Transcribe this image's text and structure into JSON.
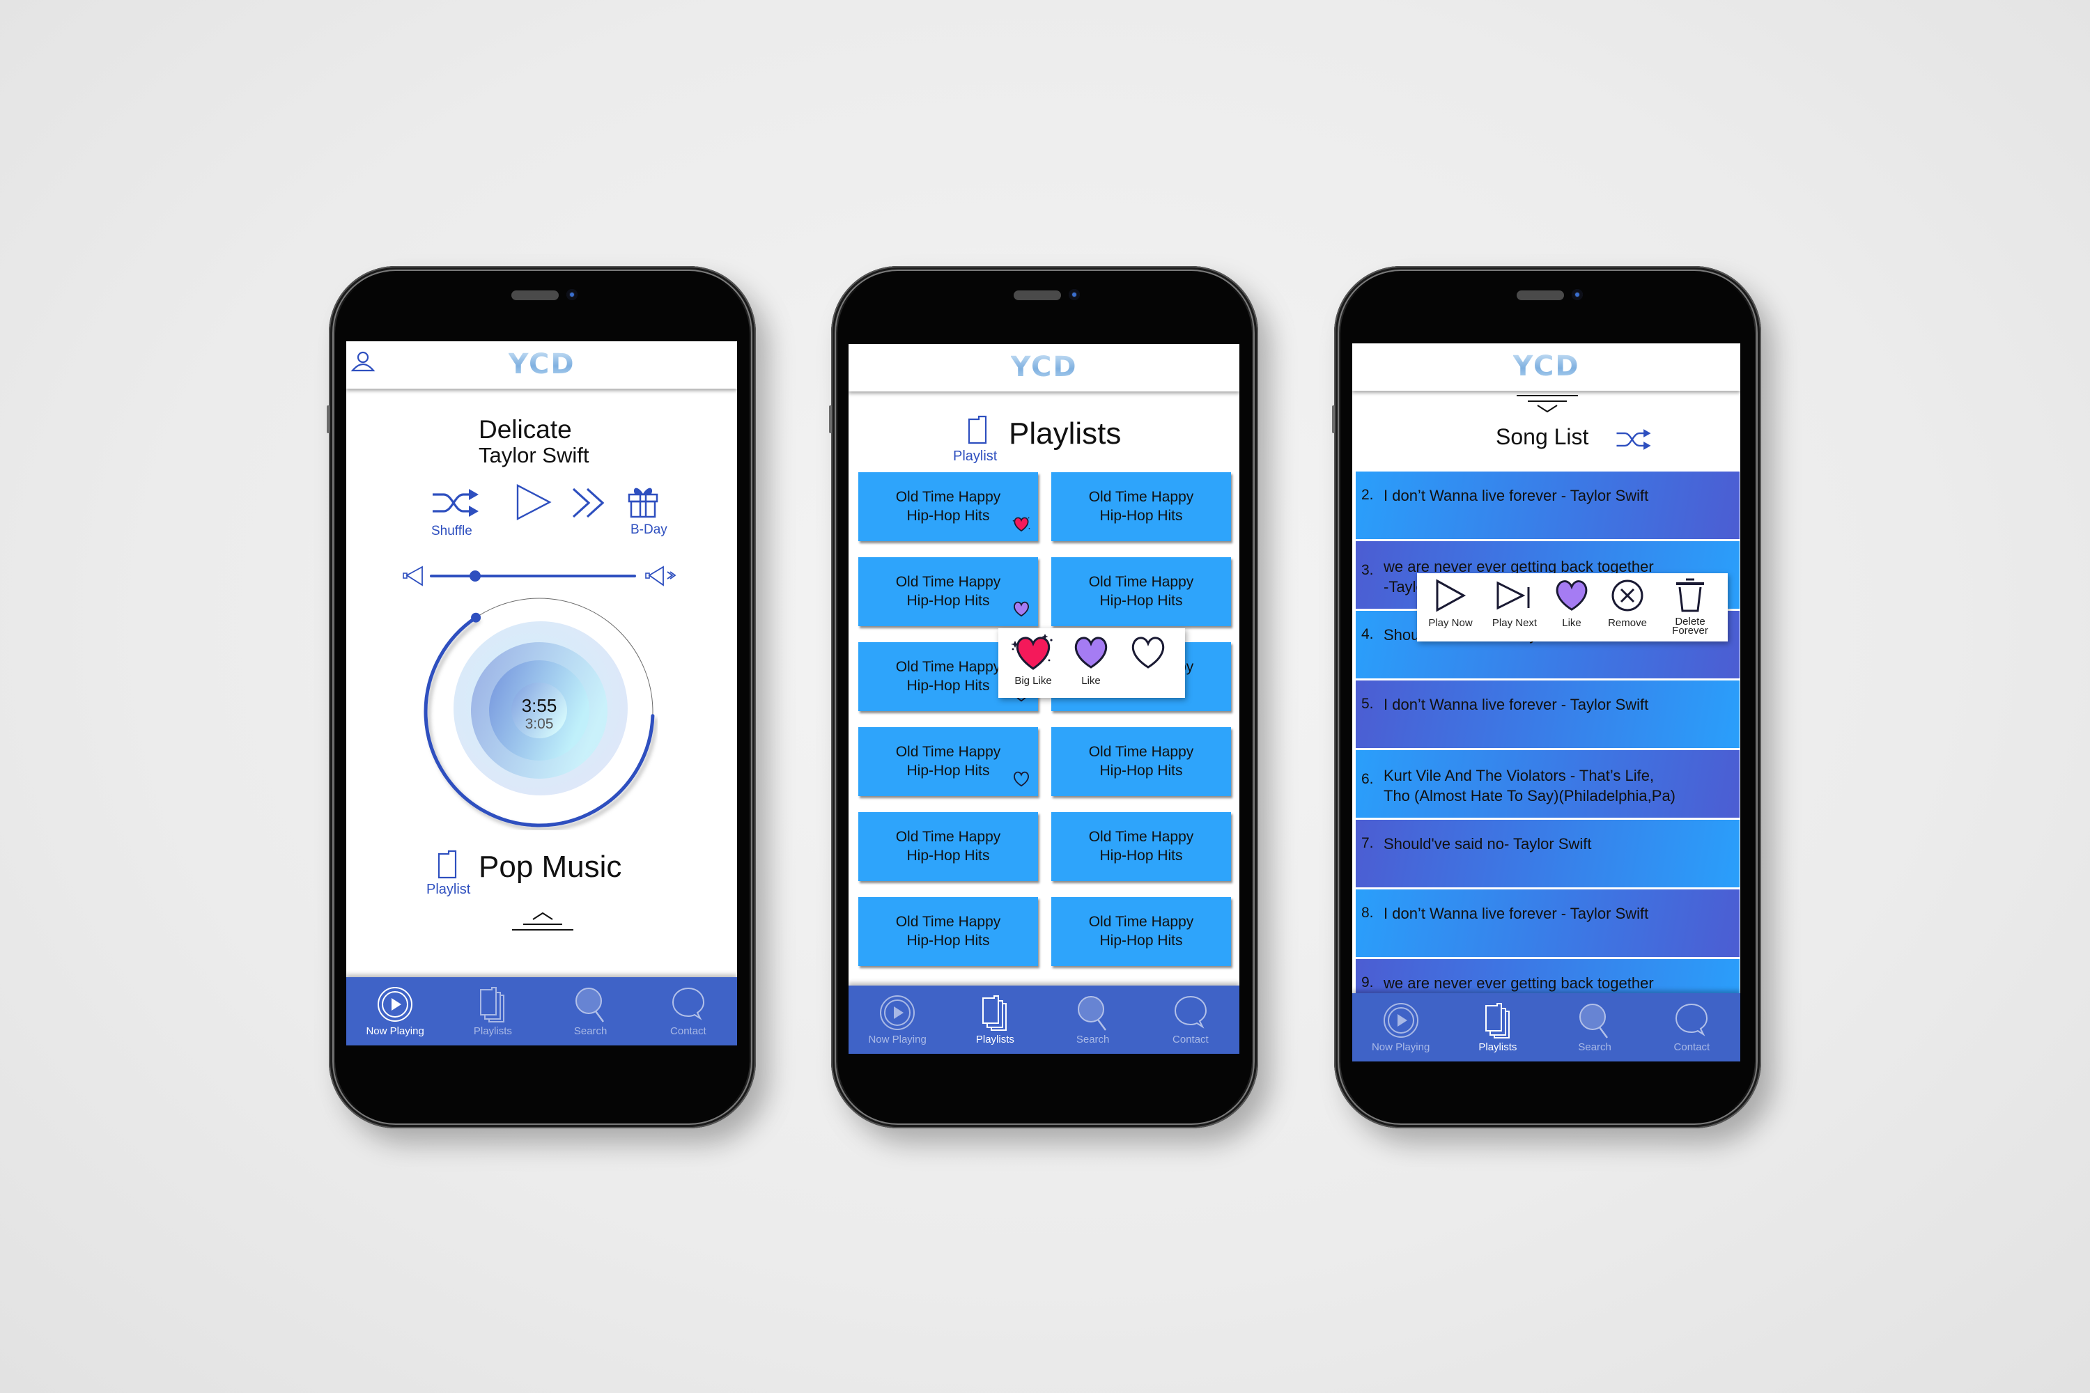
{
  "app": {
    "logo": "YCD"
  },
  "nav": {
    "items": [
      {
        "label": "Now Playing",
        "icon": "play-circle-icon"
      },
      {
        "label": "Playlists",
        "icon": "stacked-pages-icon"
      },
      {
        "label": "Search",
        "icon": "search-icon"
      },
      {
        "label": "Contact",
        "icon": "chat-bubble-icon"
      }
    ]
  },
  "colors": {
    "accent": "#2e4fbf",
    "navbar": "#3f63c7",
    "tile": "#2ea4fb",
    "big_like": "#f4195a",
    "like": "#a57cf3"
  },
  "now_playing": {
    "active_tab": "Now Playing",
    "song_title": "Delicate",
    "artist": "Taylor Swift",
    "controls": {
      "shuffle_label": "Shuffle",
      "bday_label": "B-Day"
    },
    "volume_level": 0.22,
    "time_total": "3:55",
    "time_elapsed": "3:05",
    "progress_fraction": 0.78,
    "playlist_name": "Pop Music",
    "playlist_label": "Playlist"
  },
  "playlists": {
    "active_tab": "Playlists",
    "title": "Playlists",
    "icon_label": "Playlist",
    "tiles": [
      {
        "name": "Old Time Happy\nHip-Hop Hits",
        "heart": "big-like"
      },
      {
        "name": "Old Time Happy\nHip-Hop Hits",
        "heart": "none"
      },
      {
        "name": "Old Time Happy\nHip-Hop Hits",
        "heart": "like"
      },
      {
        "name": "Old Time Happy\nHip-Hop Hits",
        "heart": "none"
      },
      {
        "name": "Old Time Happy\nHip-Hop Hits",
        "heart": "outline"
      },
      {
        "name": "Old Time Happy\nHip-Hop Hits",
        "heart": "none"
      },
      {
        "name": "Old Time Happy\nHip-Hop Hits",
        "heart": "outline"
      },
      {
        "name": "Old Time Happy\nHip-Hop Hits",
        "heart": "none"
      },
      {
        "name": "Old Time Happy\nHip-Hop Hits",
        "heart": "none"
      },
      {
        "name": "Old Time Happy\nHip-Hop Hits",
        "heart": "none"
      },
      {
        "name": "Old Time Happy\nHip-Hop Hits",
        "heart": "none"
      },
      {
        "name": "Old Time Happy\nHip-Hop Hits",
        "heart": "none"
      }
    ],
    "like_popup": {
      "options": [
        {
          "label": "Big Like",
          "icon": "big-like-heart-icon"
        },
        {
          "label": "Like",
          "icon": "like-heart-icon"
        },
        {
          "label": "",
          "icon": "outline-heart-icon"
        }
      ]
    }
  },
  "song_list": {
    "active_tab": "Playlists",
    "title": "Song List",
    "songs": [
      {
        "num": "2.",
        "text": "I don’t Wanna live forever - Taylor Swift"
      },
      {
        "num": "3.",
        "text": "we are never ever getting back  together\n-Taylor Swift"
      },
      {
        "num": "4.",
        "text": "Should've said no- Taylor Swift"
      },
      {
        "num": "5.",
        "text": "I don’t Wanna live forever - Taylor Swift"
      },
      {
        "num": "6.",
        "text": "Kurt Vile And The Violators - That’s Life,\nTho (Almost Hate To Say)(Philadelphia,Pa)"
      },
      {
        "num": "7.",
        "text": "Should've said no- Taylor Swift"
      },
      {
        "num": "8.",
        "text": "I don’t Wanna live forever - Taylor Swift"
      },
      {
        "num": "9.",
        "text": "we are never ever getting back  together"
      }
    ],
    "action_popup": {
      "options": [
        {
          "label": "Play Now",
          "icon": "play-icon"
        },
        {
          "label": "Play Next",
          "icon": "skip-next-icon"
        },
        {
          "label": "Like",
          "icon": "like-heart-icon"
        },
        {
          "label": "Remove",
          "icon": "remove-circle-x-icon"
        },
        {
          "label": "Delete\nForever",
          "icon": "trash-icon"
        }
      ]
    }
  }
}
